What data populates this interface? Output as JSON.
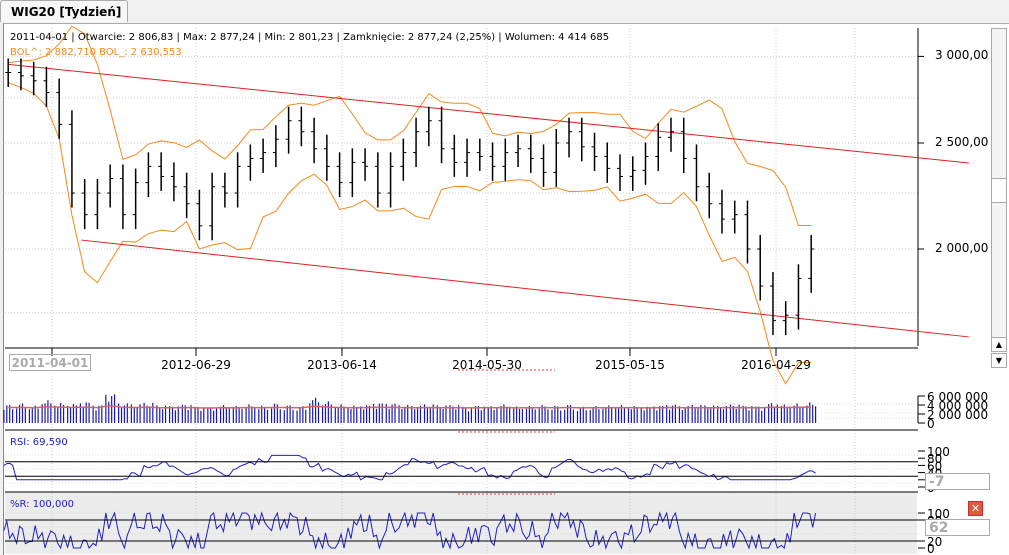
{
  "tab": {
    "label": "WIG20 [Tydzień]"
  },
  "info": {
    "line": "2011-04-01 | Otwarcie: 2 806,83 | Max: 2 877,24 | Min: 2 801,23 | Zamknięcie: 2 877,24 (2,25%)  | Wolumen: 4 414 685",
    "bollinger": "BOL^: 2 882,710  BOL_: 2 630,553"
  },
  "indicators": {
    "rsi_label": "RSI: 69,590",
    "wr_label": "%R: 100,000",
    "rsi_input": "-7",
    "wr_input": "62"
  },
  "colors": {
    "price": "#000000",
    "bollinger": "#f08a1c",
    "trendline": "#e02020",
    "volume": "#1a1aa0",
    "volume_avg": "#e06060",
    "indicator": "#2020c0"
  },
  "chart_data": {
    "type": "ohlc",
    "y_scale": "log",
    "price_ticks": [
      "3 000,00",
      "2 500,00",
      "2 000,00"
    ],
    "price_tick_values": [
      3000,
      2500,
      2000
    ],
    "x_ticks": [
      "2011-04-01",
      "2012-06-29",
      "2013-06-14",
      "2014-05-30",
      "2015-05-15",
      "2016-04-29"
    ],
    "selected_date": "2011-04-01",
    "closes": [
      2900,
      2880,
      2850,
      2780,
      2600,
      2250,
      2150,
      2250,
      2320,
      2150,
      2300,
      2380,
      2330,
      2280,
      2200,
      2100,
      2280,
      2250,
      2380,
      2420,
      2450,
      2520,
      2620,
      2560,
      2470,
      2380,
      2300,
      2400,
      2380,
      2250,
      2380,
      2450,
      2560,
      2620,
      2470,
      2400,
      2450,
      2430,
      2380,
      2450,
      2470,
      2420,
      2350,
      2500,
      2560,
      2480,
      2430,
      2370,
      2330,
      2360,
      2430,
      2530,
      2560,
      2420,
      2280,
      2200,
      2130,
      2150,
      2000,
      1850,
      1720,
      1740,
      1880,
      2000
    ],
    "first_date": "2010-12-17",
    "last_date": "2016-03-25",
    "volume_millions": [
      3.6,
      3.8,
      3.4,
      4.4,
      3.9,
      3.7,
      4.1,
      3.5,
      5.6,
      3.8,
      3.6,
      3.9,
      3.4,
      3.3,
      3.6,
      3.2,
      3.1,
      3.5,
      3.3,
      3.6,
      3.4,
      3.8,
      3.5,
      3.3,
      4.9,
      4.2,
      3.6,
      3.4,
      3.5,
      3.9,
      3.8,
      3.5,
      3.3,
      3.6,
      3.4,
      3.5,
      3.2,
      3.4,
      3.3,
      3.6,
      3.2,
      3.3,
      3.5,
      3.4,
      3.6,
      3.2,
      3.3,
      3.4,
      3.5,
      3.3,
      3.2,
      3.4,
      3.6,
      3.3,
      3.5,
      3.4,
      3.3,
      3.6,
      3.4,
      3.3,
      3.9,
      3.6,
      3.8,
      4.0
    ],
    "volume_ticks": [
      "6 000 000",
      "4 000 000",
      "2 000 000",
      "0"
    ],
    "rsi_ticks": [
      "100",
      "80",
      "60",
      "40",
      "20",
      "0"
    ],
    "rsi_levels": [
      70,
      30
    ],
    "wr_ticks": [
      "100",
      "80",
      "20",
      "0"
    ],
    "wr_levels": [
      80,
      20
    ],
    "trendlines": [
      {
        "from": [
          "2010-12-17",
          2950
        ],
        "to": [
          "2017-04-07",
          2397
        ]
      },
      {
        "from": [
          "2011-06-10",
          2038
        ],
        "to": [
          "2017-04-07",
          1662
        ]
      }
    ]
  }
}
